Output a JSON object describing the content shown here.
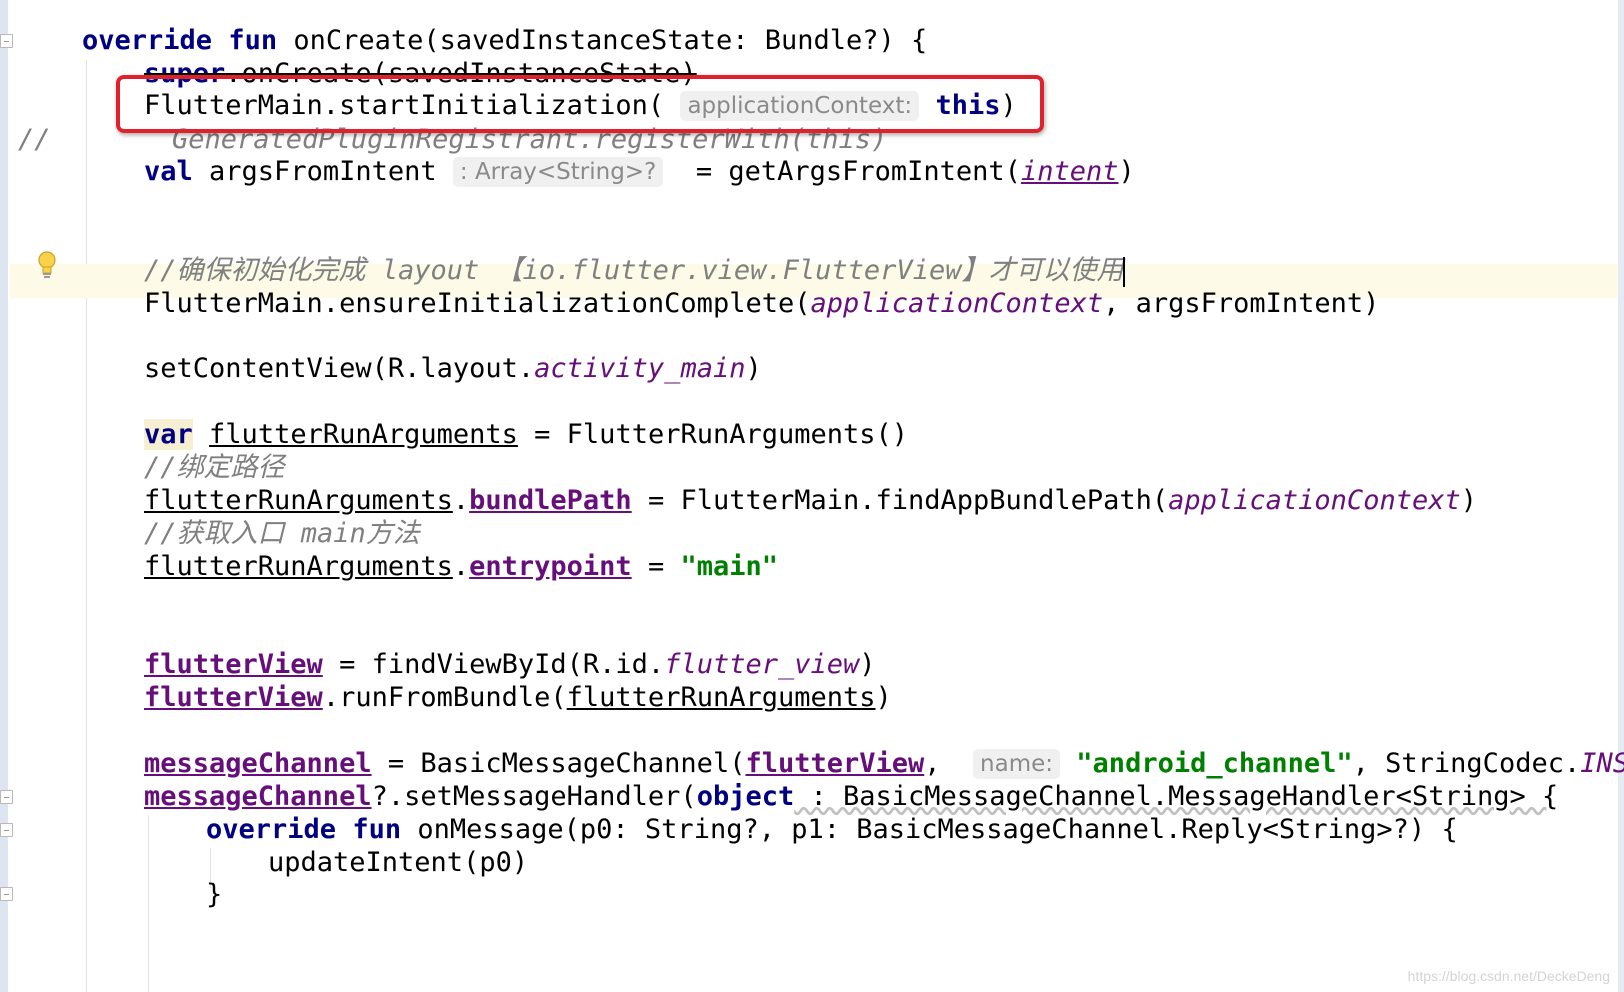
{
  "editor": {
    "lines": {
      "l1": {
        "kw1": "override",
        "kw2": "fun",
        "text": " onCreate(savedInstanceState: Bundle?) {"
      },
      "l2": {
        "kw": "super",
        "text": ".onCreate(savedInstanceState)"
      },
      "l3": {
        "text": "FlutterMain.startInitialization(",
        "hint": "applicationContext:",
        "kw": "this",
        "close": ")"
      },
      "l4": {
        "prefix": "//",
        "text": "GeneratedPluginRegistrant.registerWith(this)"
      },
      "l5": {
        "kw": "val",
        "name": " argsFromIntent",
        "hint": ": Array<String>?",
        "text": " = getArgsFromIntent(",
        "ital": "intent",
        "close": ")"
      },
      "l6": {
        "comment_a": "//确保初始化完成 layout ",
        "comment_b": "【io.flutter.view.FlutterView】",
        "comment_c": "才可以使用"
      },
      "l7": {
        "text": "FlutterMain.ensureInitializationComplete(",
        "ital": "applicationContext",
        "rest": ", argsFromIntent)"
      },
      "l8": {
        "text": "setContentView(R.layout.",
        "ital": "activity_main",
        "close": ")"
      },
      "l9": {
        "kw": "var",
        "var": "flutterRunArguments",
        "text": " = FlutterRunArguments()"
      },
      "l10": {
        "comment": "//绑定路径"
      },
      "l11": {
        "var": "flutterRunArguments",
        "dot": ".",
        "prop": "bundlePath",
        "text": " = FlutterMain.findAppBundlePath(",
        "ital": "applicationContext",
        "close": ")"
      },
      "l12": {
        "comment": "//获取入口 main方法"
      },
      "l13": {
        "var": "flutterRunArguments",
        "dot": ".",
        "prop": "entrypoint",
        "eq": " = ",
        "str": "\"main\""
      },
      "l14": {
        "prop": "flutterView",
        "text": " = findViewById(R.id.",
        "ital": "flutter_view",
        "close": ")"
      },
      "l15": {
        "prop": "flutterView",
        "text": ".runFromBundle(",
        "var": "flutterRunArguments",
        "close": ")"
      },
      "l16": {
        "prop": "messageChannel",
        "text": " = BasicMessageChannel(",
        "prop2": "flutterView",
        "comma": ", ",
        "hint": "name:",
        "str": "\"android_channel\"",
        "rest": ", StringCodec.",
        "ital": "INSTANCE"
      },
      "l17": {
        "prop": "messageChannel",
        "text": "?.setMessageHandler(",
        "kw": "object",
        "rest": " : BasicMessageChannel.MessageHandler<String> {"
      },
      "l18": {
        "kw1": "override",
        "kw2": "fun",
        "text": " onMessage(p0: String?, p1: BasicMessageChannel.Reply<String>?) {"
      },
      "l19": {
        "text": "updateIntent(p0)"
      },
      "l20": {
        "text": "}"
      }
    },
    "watermark": "https://blog.csdn.net/DeckeDeng"
  },
  "colors": {
    "keyword": "#000080",
    "comment": "#808080",
    "string": "#008000",
    "property": "#660e7a",
    "highlight_box": "#e0202a",
    "caret_row": "#fdfbe7"
  },
  "icons": {
    "bulb": "lightbulb-icon",
    "fold": "fold-marker-icon"
  }
}
